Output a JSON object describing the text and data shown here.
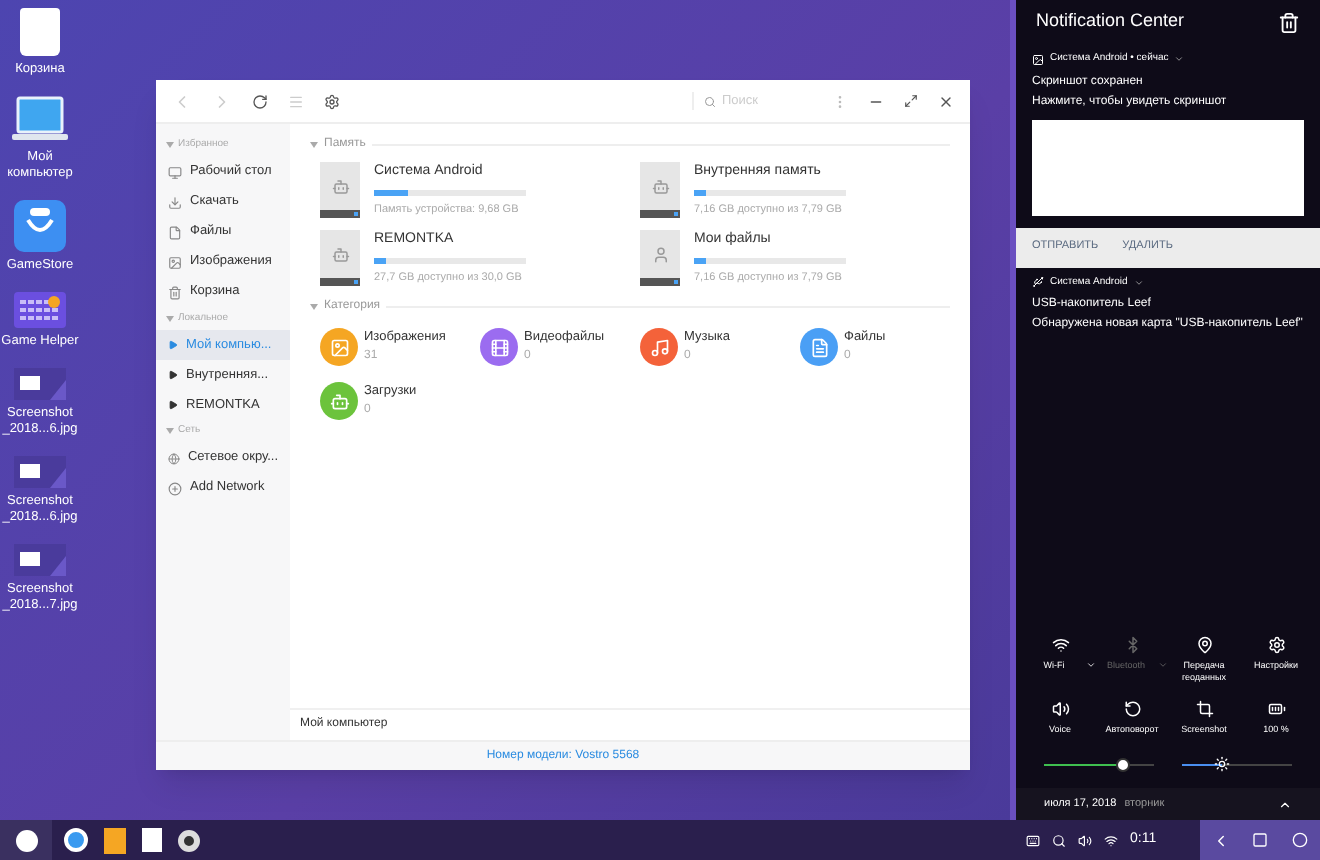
{
  "desktop_icons": [
    {
      "label": "Корзина"
    },
    {
      "label": "Мой компьютер"
    },
    {
      "label": "GameStore"
    },
    {
      "label": "Game Helper"
    },
    {
      "label": "Screenshot _2018...6.jpg"
    },
    {
      "label": "Screenshot _2018...6.jpg"
    },
    {
      "label": "Screenshot _2018...7.jpg"
    }
  ],
  "file_manager": {
    "search": {
      "placeholder": "Поиск"
    },
    "sidebar": [
      {
        "heading": "Избранное",
        "items": [
          {
            "label": "Рабочий стол",
            "kind": "link",
            "selected": false
          },
          {
            "label": "Скачать",
            "kind": "link",
            "selected": false
          },
          {
            "label": "Файлы",
            "kind": "link",
            "selected": false
          },
          {
            "label": "Изображения",
            "kind": "link",
            "selected": false
          },
          {
            "label": "Корзина",
            "kind": "link",
            "selected": false
          }
        ]
      },
      {
        "heading": "Локальное",
        "items": [
          {
            "label": "Мой компью...",
            "kind": "expandable",
            "selected": true
          },
          {
            "label": "Внутренняя...",
            "kind": "expandable",
            "selected": false
          },
          {
            "label": "REMONTKA",
            "kind": "expandable",
            "selected": false
          }
        ]
      },
      {
        "heading": "Сеть",
        "items": [
          {
            "label": "Сетевое окру...",
            "kind": "link",
            "selected": false
          },
          {
            "label": "Add Network",
            "kind": "link",
            "selected": false
          }
        ]
      }
    ],
    "memory_heading": "Память",
    "storage": [
      {
        "name": "Система Android",
        "detail": "Память устройства: 9,68 GB",
        "level": 0.23,
        "kind": "android"
      },
      {
        "name": "Внутренняя память",
        "detail": "7,16 GB доступно из 7,79 GB",
        "level": 0.08,
        "kind": "android"
      },
      {
        "name": "REMONTKA",
        "detail": "27,7 GB доступно из 30,0 GB",
        "level": 0.08,
        "kind": "android"
      },
      {
        "name": "Мои файлы",
        "detail": "7,16 GB доступно из 7,79 GB",
        "level": 0.08,
        "kind": "user"
      }
    ],
    "category_heading": "Категория",
    "categories": [
      {
        "name": "Изображения",
        "count": "31",
        "color": "#f5a623"
      },
      {
        "name": "Видеофайлы",
        "count": "0",
        "color": "#9b6cf0"
      },
      {
        "name": "Музыка",
        "count": "0",
        "color": "#f4623a"
      },
      {
        "name": "Файлы",
        "count": "0",
        "color": "#4a9ff5"
      },
      {
        "name": "Загрузки",
        "count": "0",
        "color": "#6cc33c"
      }
    ],
    "path": "Мой компьютер",
    "footer": "Номер модели: Vostro 5568"
  },
  "notification_center": {
    "title": "Notification Center",
    "notifications": [
      {
        "app": "Система Android • сейчас",
        "title": "Скриншот сохранен",
        "text": "Нажмите, чтобы увидеть скриншот",
        "kind": "image",
        "actions": [
          "ОТПРАВИТЬ",
          "УДАЛИТЬ"
        ]
      },
      {
        "app": "Система Android",
        "title": "USB-накопитель Leef",
        "text": "Обнаружена новая карта \"USB-накопитель Leef\"",
        "kind": "usb"
      }
    ],
    "tiles": [
      {
        "label": "Wi-Fi",
        "on": true,
        "caret": true
      },
      {
        "label": "Bluetooth",
        "on": false,
        "caret": true
      },
      {
        "label": "Передача геоданных",
        "on": true,
        "caret": false
      },
      {
        "label": "Настройки",
        "on": true,
        "caret": false
      },
      {
        "label": "Voice",
        "on": true,
        "caret": false
      },
      {
        "label": "Автоповорот",
        "on": true,
        "caret": false
      },
      {
        "label": "Screenshot",
        "on": true,
        "caret": false
      },
      {
        "label": "100 %",
        "on": true,
        "caret": false
      }
    ],
    "sliders": [
      {
        "kind": "volume",
        "level": 0.7
      },
      {
        "kind": "brightness",
        "level": 0.37
      }
    ],
    "date": "июля 17, 2018",
    "weekday": "вторник"
  },
  "taskbar": {
    "clock": "0:11"
  }
}
